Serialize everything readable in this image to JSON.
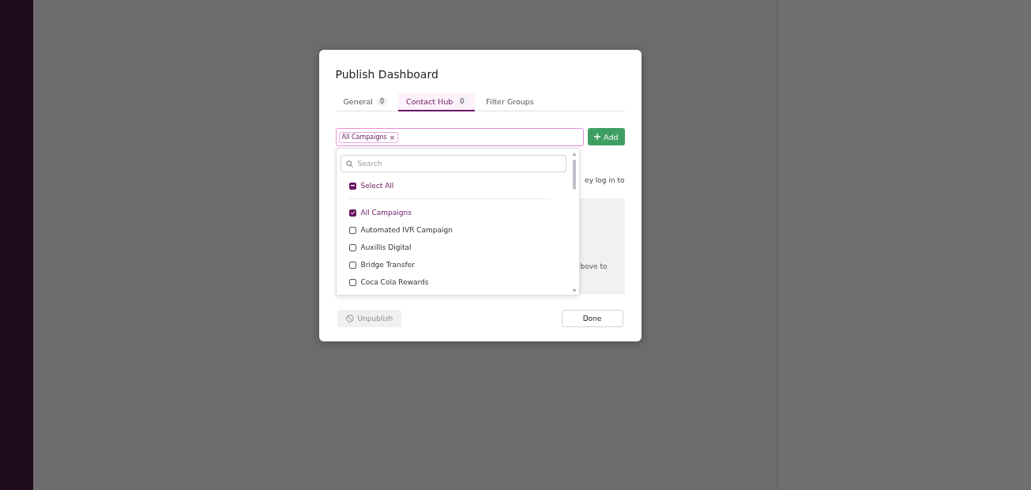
{
  "dialog": {
    "title": "Publish Dashboard",
    "tabs": [
      {
        "label": "General",
        "count": "0",
        "selected": false
      },
      {
        "label": "Contact Hub",
        "count": "0",
        "selected": true
      },
      {
        "label": "Filter Groups",
        "selected": false
      }
    ],
    "selector": {
      "chips": [
        "All Campaigns"
      ],
      "chip_remove": "×",
      "add_button": "Add"
    },
    "dropdown": {
      "search": {
        "placeholder": "Search"
      },
      "select_all": {
        "label": "Select All",
        "indeterminate": true
      },
      "options": [
        {
          "label": "All Campaigns",
          "checked": true
        },
        {
          "label": "Automated IVR Campaign",
          "checked": false
        },
        {
          "label": "Auxillis Digital",
          "checked": false
        },
        {
          "label": "Bridge Transfer",
          "checked": false
        },
        {
          "label": "Coca Cola Rewards",
          "checked": false
        }
      ]
    },
    "hidden_text_fragments": [
      "ey log in to",
      "bove to"
    ],
    "footer": {
      "unpublish": {
        "label": "Unpublish",
        "disabled": true
      },
      "done": "Done"
    }
  }
}
